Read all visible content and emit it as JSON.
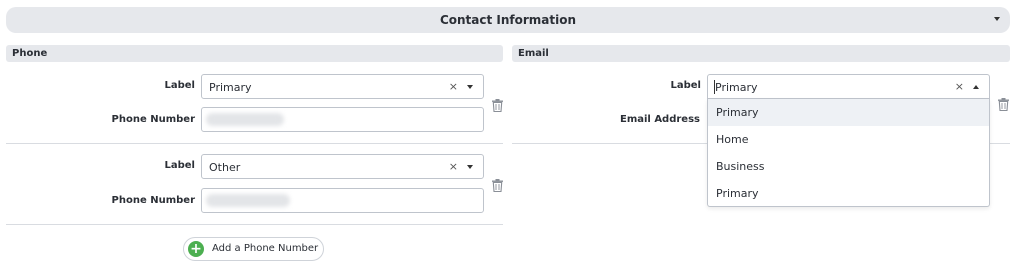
{
  "header": {
    "title": "Contact Information",
    "chevron_icon": "chevron-down-icon"
  },
  "phone": {
    "section_title": "Phone",
    "entries": [
      {
        "label_caption": "Label",
        "label_value": "Primary",
        "number_caption": "Phone Number",
        "clear_symbol": "×"
      },
      {
        "label_caption": "Label",
        "label_value": "Other",
        "number_caption": "Phone Number",
        "clear_symbol": "×"
      }
    ],
    "add_button_label": "Add a Phone Number"
  },
  "email": {
    "section_title": "Email",
    "label_caption": "Label",
    "label_value": "Primary",
    "address_caption": "Email Address",
    "clear_symbol": "×",
    "dropdown_options": [
      "Primary",
      "Home",
      "Business",
      "Primary"
    ],
    "highlighted_option": "Primary"
  },
  "colors": {
    "section_bg": "#e6e8ec",
    "add_icon_green": "#4caf50",
    "border": "#bfc4cc"
  }
}
